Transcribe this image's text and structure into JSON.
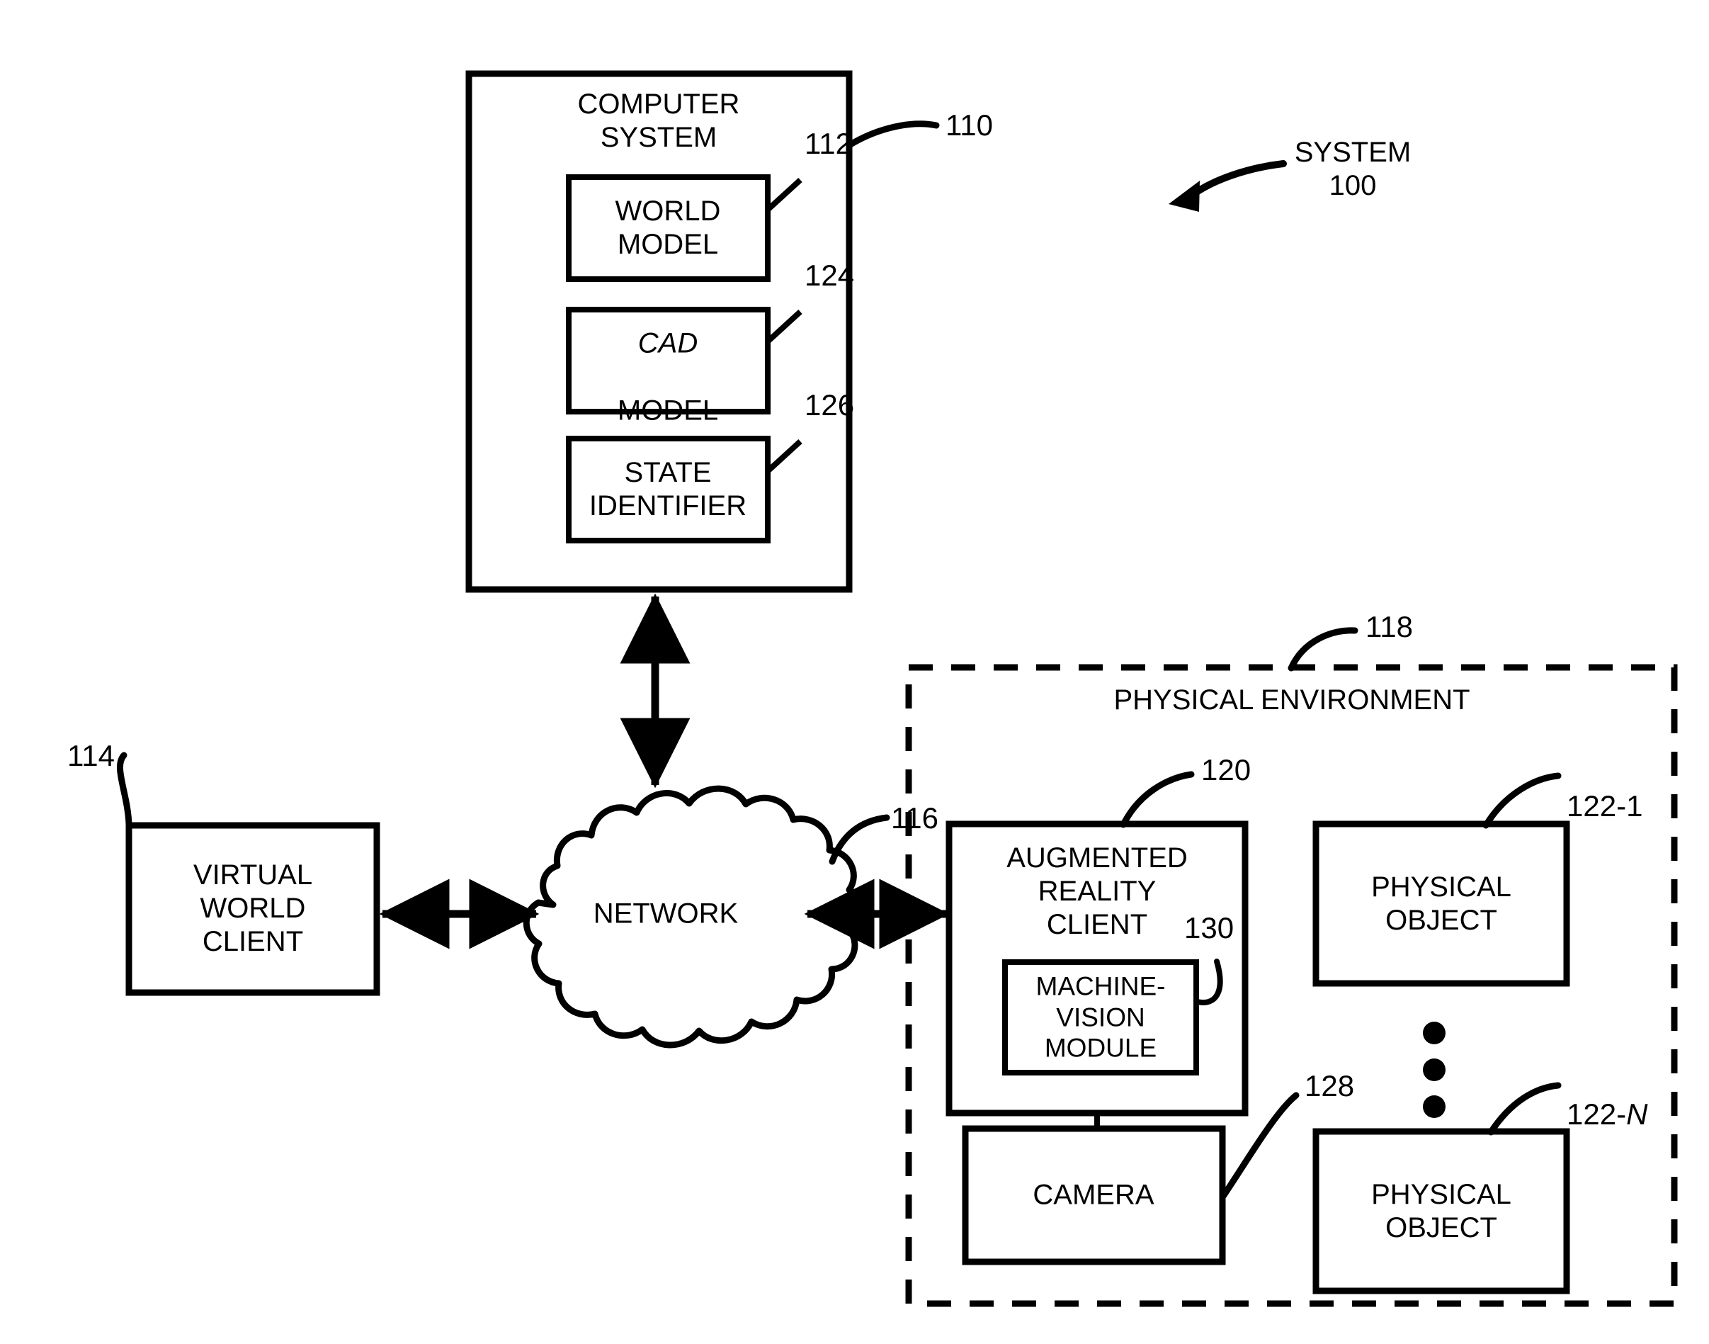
{
  "figure": {
    "type": "patent-block-diagram",
    "background_color": "#ffffff",
    "line_color": "#000000"
  },
  "system_callout": {
    "label": "SYSTEM\n100",
    "name": "SYSTEM",
    "number": "100"
  },
  "computer_system": {
    "title": "COMPUTER\nSYSTEM",
    "ref": "110",
    "children": [
      {
        "title": "WORLD\nMODEL",
        "ref": "112",
        "italic_first_word": false
      },
      {
        "title_italic": "CAD",
        "title_rest": "MODEL",
        "ref": "124",
        "italic_first_word": true
      },
      {
        "title": "STATE\nIDENTIFIER",
        "ref": "126",
        "italic_first_word": false
      }
    ]
  },
  "virtual_world_client": {
    "title": "VIRTUAL\nWORLD\nCLIENT",
    "ref": "114"
  },
  "network": {
    "title": "NETWORK",
    "ref": "116"
  },
  "physical_environment": {
    "title": "PHYSICAL ENVIRONMENT",
    "ref": "118"
  },
  "augmented_reality_client": {
    "title": "AUGMENTED\nREALITY\nCLIENT",
    "ref": "120",
    "module": {
      "title": "MACHINE-\nVISION\nMODULE",
      "ref": "130"
    }
  },
  "camera": {
    "title": "CAMERA",
    "ref": "128"
  },
  "physical_objects": [
    {
      "title": "PHYSICAL\nOBJECT",
      "ref_prefix": "122-",
      "ref_suffix": "1",
      "suffix_italic": false
    },
    {
      "title": "PHYSICAL\nOBJECT",
      "ref_prefix": "122-",
      "ref_suffix": "N",
      "suffix_italic": true
    }
  ],
  "ellipsis": {
    "name": "vertical-ellipsis",
    "dots": 3
  },
  "connections": [
    {
      "from": "computer-system",
      "to": "network",
      "style": "double-arrow-vertical"
    },
    {
      "from": "virtual-world-client",
      "to": "network",
      "style": "double-arrow-horizontal"
    },
    {
      "from": "network",
      "to": "augmented-reality-client",
      "style": "double-arrow-horizontal"
    },
    {
      "from": "augmented-reality-client",
      "to": "camera",
      "style": "plain-line-vertical"
    }
  ]
}
